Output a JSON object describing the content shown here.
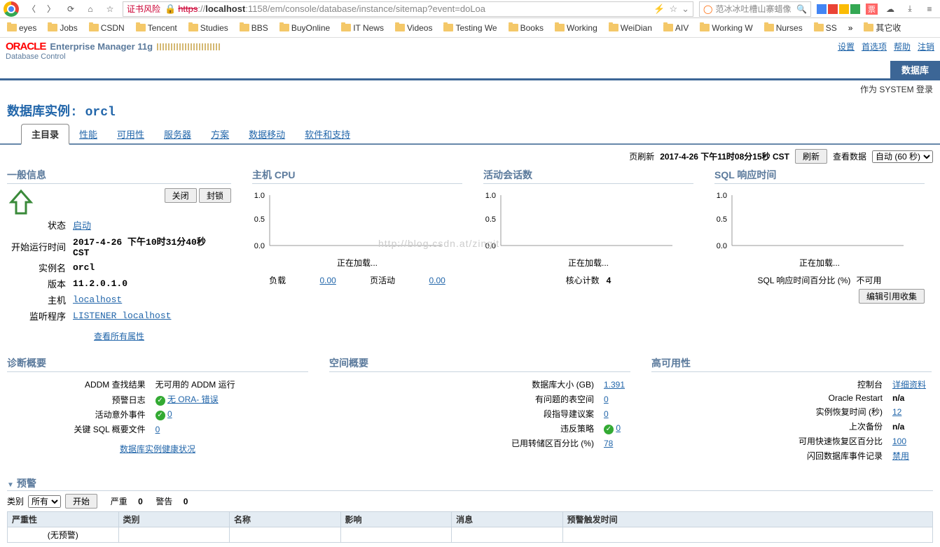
{
  "browser": {
    "cert_risk": "证书风险",
    "url_prefix": "https",
    "url_host": "localhost",
    "url_rest": ":1158/em/console/database/instance/sitemap?event=doLoa",
    "search_placeholder": "范冰冰吐槽山寨蜡像"
  },
  "bookmarks": [
    "eyes",
    "Jobs",
    "CSDN",
    "Tencent",
    "Studies",
    "BBS",
    "BuyOnline",
    "IT News",
    "Videos",
    "Testing We",
    "Books",
    "Working",
    "WeiDian",
    "AIV",
    "Working W",
    "Nurses",
    "SS",
    "",
    "其它收"
  ],
  "header": {
    "oracle": "ORACLE",
    "title": "Enterprise Manager 11g",
    "subtitle": "Database Control",
    "links": [
      "设置",
      "首选项",
      "帮助",
      "注销"
    ],
    "db_tab": "数据库",
    "login_as": "作为 SYSTEM 登录"
  },
  "page": {
    "title_label": "数据库实例: ",
    "instance": "orcl",
    "tabs": [
      "主目录",
      "性能",
      "可用性",
      "服务器",
      "方案",
      "数据移动",
      "软件和支持"
    ]
  },
  "refresh": {
    "label": "页刷新",
    "time": "2017-4-26 下午11时08分15秒 CST",
    "btn": "刷新",
    "view_label": "查看数据",
    "select": "自动 (60 秒)"
  },
  "general": {
    "title": "一般信息",
    "close_btn": "关闭",
    "lock_btn": "封锁",
    "rows": {
      "status_l": "状态",
      "status_v": "启动",
      "start_l": "开始运行时间",
      "start_v": "2017-4-26 下午10时31分40秒 CST",
      "inst_l": "实例名",
      "inst_v": "orcl",
      "ver_l": "版本",
      "ver_v": "11.2.0.1.0",
      "host_l": "主机",
      "host_v": "localhost",
      "lsn_l": "监听程序",
      "lsn_v": "LISTENER_localhost"
    },
    "view_all": "查看所有属性"
  },
  "host_cpu": {
    "title": "主机 CPU",
    "loading": "正在加载...",
    "load_l": "负载",
    "load_v": "0.00",
    "act_l": "页活动",
    "act_v": "0.00"
  },
  "sessions": {
    "title": "活动会话数",
    "loading": "正在加载...",
    "cores_l": "核心计数",
    "cores_v": "4"
  },
  "sql": {
    "title": "SQL 响应时间",
    "loading": "正在加载...",
    "pct_l": "SQL 响应时间百分比 (%)",
    "pct_v": "不可用",
    "edit_btn": "编辑引用收集"
  },
  "chart_data": [
    {
      "type": "line",
      "title": "主机 CPU",
      "ylim": [
        0,
        1
      ],
      "yticks": [
        0.0,
        0.5,
        1.0
      ],
      "series": []
    },
    {
      "type": "line",
      "title": "活动会话数",
      "ylim": [
        0,
        1
      ],
      "yticks": [
        0.0,
        0.5,
        1.0
      ],
      "series": []
    },
    {
      "type": "line",
      "title": "SQL 响应时间",
      "ylim": [
        0,
        1
      ],
      "yticks": [
        0.0,
        0.5,
        1.0
      ],
      "series": []
    }
  ],
  "diag": {
    "title": "诊断概要",
    "rows": {
      "addm_l": "ADDM 查找结果",
      "addm_v": "无可用的 ADDM 运行",
      "alert_l": "预警日志",
      "alert_v": "无 ORA- 错误",
      "inc_l": "活动意外事件",
      "inc_v": "0",
      "sql_l": "关键 SQL 概要文件",
      "sql_v": "0"
    },
    "health": "数据库实例健康状况"
  },
  "space": {
    "title": "空间概要",
    "rows": {
      "size_l": "数据库大小 (GB)",
      "size_v": "1.391",
      "ts_l": "有问题的表空间",
      "ts_v": "0",
      "seg_l": "段指导建议案",
      "seg_v": "0",
      "pol_l": "违反策略",
      "pol_v": "0",
      "dump_l": "已用转储区百分比 (%)",
      "dump_v": "78"
    }
  },
  "ha": {
    "title": "高可用性",
    "rows": {
      "con_l": "控制台",
      "con_v": "详细资料",
      "rst_l": "Oracle Restart",
      "rst_v": "n/a",
      "rec_l": "实例恢复时间 (秒)",
      "rec_v": "12",
      "bak_l": "上次备份",
      "bak_v": "n/a",
      "fra_l": "可用快速恢复区百分比",
      "fra_v": "100",
      "flash_l": "闪回数据库事件记录",
      "flash_v": "禁用"
    }
  },
  "alerts": {
    "title": "预警",
    "cat_l": "类别",
    "all": "所有",
    "go": "开始",
    "sev_l": "严重",
    "sev_v": "0",
    "warn_l": "警告",
    "warn_v": "0",
    "cols": [
      "严重性",
      "类别",
      "名称",
      "影响",
      "消息",
      "预警触发时间"
    ],
    "empty": "(无预警)"
  },
  "watermark": "http://blog.csdn.at/zingit"
}
